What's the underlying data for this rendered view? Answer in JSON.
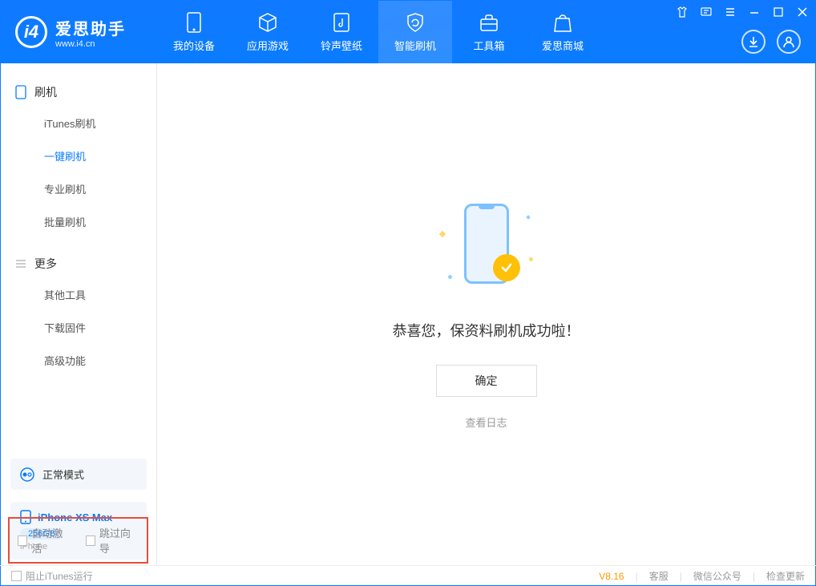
{
  "app": {
    "title": "爱思助手",
    "subtitle": "www.i4.cn"
  },
  "nav": {
    "items": [
      {
        "label": "我的设备"
      },
      {
        "label": "应用游戏"
      },
      {
        "label": "铃声壁纸"
      },
      {
        "label": "智能刷机"
      },
      {
        "label": "工具箱"
      },
      {
        "label": "爱思商城"
      }
    ]
  },
  "sidebar": {
    "group1": {
      "title": "刷机",
      "items": [
        "iTunes刷机",
        "一键刷机",
        "专业刷机",
        "批量刷机"
      ]
    },
    "group2": {
      "title": "更多",
      "items": [
        "其他工具",
        "下载固件",
        "高级功能"
      ]
    }
  },
  "device_status": {
    "mode": "正常模式"
  },
  "device": {
    "name": "iPhone XS Max",
    "capacity": "256GB",
    "type": "iPhone"
  },
  "main": {
    "success_message": "恭喜您，保资料刷机成功啦！",
    "ok_button": "确定",
    "log_link": "查看日志"
  },
  "options": {
    "auto_activate": "自动激活",
    "skip_guide": "跳过向导"
  },
  "status": {
    "block_itunes": "阻止iTunes运行",
    "version": "V8.16",
    "links": [
      "客服",
      "微信公众号",
      "检查更新"
    ]
  }
}
